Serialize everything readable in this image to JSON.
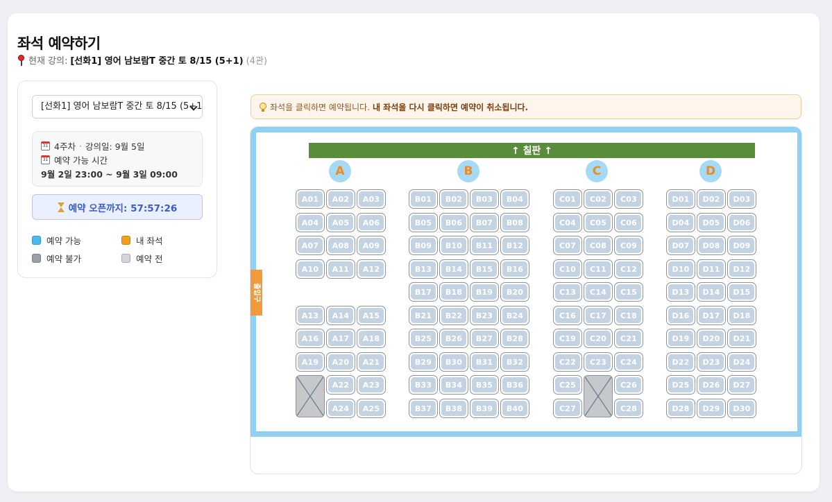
{
  "page": {
    "title": "좌석 예약하기",
    "lecture_label": "현재 강의:",
    "lecture_name": "[선화1] 영어 남보람T 중간 토 8/15 (5+1)",
    "lecture_room": "(4관)"
  },
  "sidebar": {
    "select_value": "[선화1] 영어 남보람T 중간 토 8/15 (5+1",
    "week": "4주차",
    "lecture_date": "강의일: 9월 5일",
    "reserve_window_label": "예약 가능 시간",
    "reserve_window": "9월 2일 23:00 ~ 9월 3일 09:00",
    "timer_label": "예약 오픈까지: 57:57:26",
    "legend": [
      {
        "label": "예약 가능",
        "color": "#4cb8ec"
      },
      {
        "label": "내 좌석",
        "color": "#f0a020"
      },
      {
        "label": "예약 불가",
        "color": "#9aa0a6"
      },
      {
        "label": "예약 전",
        "color": "#d3d5d8"
      }
    ]
  },
  "notice": {
    "text": "좌석을 클릭하면 예약됩니다.",
    "bold": "내 좌석을 다시 클릭하면 예약이 취소됩니다."
  },
  "room": {
    "blackboard": "↑ 칠판 ↑",
    "door": "출입구",
    "columns": [
      "A",
      "B",
      "C",
      "D"
    ],
    "seats": {
      "A": [
        "A01",
        "A02",
        "A03",
        "A04",
        "A05",
        "A06",
        "A07",
        "A08",
        "A09",
        "A10",
        "A11",
        "A12",
        "A13",
        "A14",
        "A15",
        "A16",
        "A17",
        "A18",
        "A19",
        "A20",
        "A21",
        "A22",
        "A23",
        "A24",
        "A25"
      ],
      "B": [
        "B01",
        "B02",
        "B03",
        "B04",
        "B05",
        "B06",
        "B07",
        "B08",
        "B09",
        "B10",
        "B11",
        "B12",
        "B13",
        "B14",
        "B15",
        "B16",
        "B17",
        "B18",
        "B19",
        "B20",
        "B21",
        "B22",
        "B23",
        "B24",
        "B25",
        "B26",
        "B27",
        "B28",
        "B29",
        "B30",
        "B31",
        "B32",
        "B33",
        "B34",
        "B35",
        "B36",
        "B37",
        "B38",
        "B39",
        "B40"
      ],
      "C": [
        "C01",
        "C02",
        "C03",
        "C04",
        "C05",
        "C06",
        "C07",
        "C08",
        "C09",
        "C10",
        "C11",
        "C12",
        "C13",
        "C14",
        "C15",
        "C16",
        "C17",
        "C18",
        "C19",
        "C20",
        "C21",
        "C22",
        "C23",
        "C24",
        "C25",
        "C26",
        "C27",
        "C28"
      ],
      "D": [
        "D01",
        "D02",
        "D03",
        "D04",
        "D05",
        "D06",
        "D07",
        "D08",
        "D09",
        "D10",
        "D11",
        "D12",
        "D13",
        "D14",
        "D15",
        "D16",
        "D17",
        "D18",
        "D19",
        "D20",
        "D21",
        "D22",
        "D23",
        "D24",
        "D25",
        "D26",
        "D27",
        "D28",
        "D29",
        "D30"
      ]
    }
  }
}
